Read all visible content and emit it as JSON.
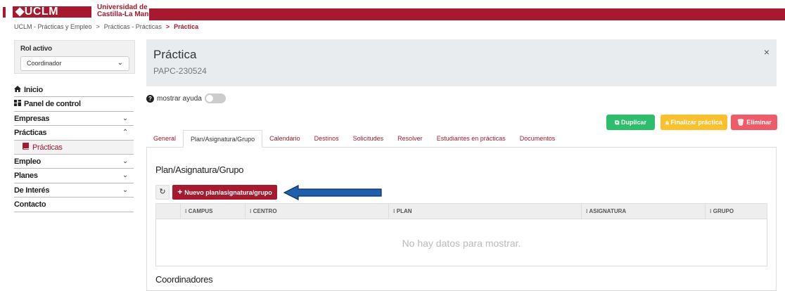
{
  "brand": {
    "logo": "◆UCLM",
    "university_line1": "Universidad de",
    "university_line2": "Castilla-La Mancha"
  },
  "breadcrumb": [
    {
      "label": "UCLM - Prácticas y Empleo"
    },
    {
      "label": "Prácticas - Prácticas"
    },
    {
      "label": "Práctica"
    }
  ],
  "breadcrumb_sep": ">",
  "rol": {
    "label": "Rol activo",
    "value": "Coordinador"
  },
  "sidebar": {
    "items": [
      {
        "label": "Inicio",
        "icon": "home-icon"
      },
      {
        "label": "Panel de control",
        "icon": "dashboard-icon"
      },
      {
        "label": "Empresas",
        "chevron": "down"
      },
      {
        "label": "Prácticas",
        "chevron": "up"
      },
      {
        "label": "Prácticas",
        "icon": "book-icon",
        "sub": true
      },
      {
        "label": "Empleo",
        "chevron": "down"
      },
      {
        "label": "Planes",
        "chevron": "down"
      },
      {
        "label": "De Interés",
        "chevron": "down"
      },
      {
        "label": "Contacto"
      }
    ]
  },
  "header": {
    "title": "Práctica",
    "code": "PAPC-230524",
    "close": "×"
  },
  "help": {
    "label": "mostrar ayuda",
    "icon": "?"
  },
  "actions": {
    "duplicate": "Duplicar",
    "finish": "Finalizar práctica",
    "delete": "Eliminar"
  },
  "tabs": [
    {
      "label": "General"
    },
    {
      "label": "Plan/Asignatura/Grupo",
      "active": true
    },
    {
      "label": "Calendario"
    },
    {
      "label": "Destinos"
    },
    {
      "label": "Solicitudes"
    },
    {
      "label": "Resolver"
    },
    {
      "label": "Estudiantes en prácticas"
    },
    {
      "label": "Documentos"
    }
  ],
  "section": {
    "title": "Plan/Asignatura/Grupo",
    "new_button": "Nuevo plan/asignatura/grupo",
    "refresh_icon": "↻",
    "columns": [
      "⁝ CAMPUS",
      "⁝ CENTRO",
      "⁝ PLAN",
      "⁝ ASIGNATURA",
      "⁝ GRUPO"
    ],
    "empty_text": "No hay datos para mostrar."
  },
  "section2": {
    "title": "Coordinadores"
  },
  "colors": {
    "brand": "#a6192e",
    "success": "#2dbe6c",
    "warning": "#fbc02d",
    "danger": "#ef5c67",
    "arrow": "#1f5fad"
  }
}
